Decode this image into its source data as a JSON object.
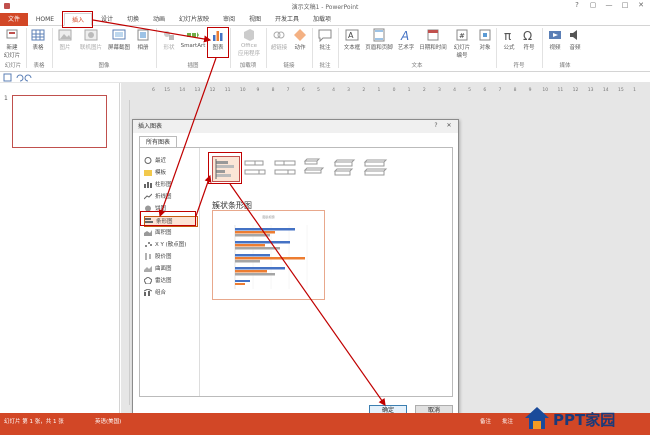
{
  "titlebar": {
    "title": "演示文稿1 - PowerPoint",
    "buttons": [
      "?",
      "▢",
      "—",
      "□",
      "✕"
    ]
  },
  "tabs": [
    {
      "label": "文件"
    },
    {
      "label": "HOME"
    },
    {
      "label": "插入"
    },
    {
      "label": "设计"
    },
    {
      "label": "切换"
    },
    {
      "label": "动画"
    },
    {
      "label": "幻灯片放映"
    },
    {
      "label": "审阅"
    },
    {
      "label": "视图"
    },
    {
      "label": "开发工具"
    },
    {
      "label": "加载项"
    }
  ],
  "ribbon": {
    "buttons": [
      {
        "label": "新建\n幻灯片"
      },
      {
        "label": "表格"
      },
      {
        "label": "图片"
      },
      {
        "label": "联机图片"
      },
      {
        "label": "屏幕截图"
      },
      {
        "label": "相册"
      },
      {
        "label": "形状"
      },
      {
        "label": "SmartArt"
      },
      {
        "label": "图表"
      },
      {
        "label": "Office\n应用程序"
      },
      {
        "label": "超链接"
      },
      {
        "label": "动作"
      },
      {
        "label": "批注"
      },
      {
        "label": "文本框"
      },
      {
        "label": "页眉和页脚"
      },
      {
        "label": "艺术字"
      },
      {
        "label": "日期和时间"
      },
      {
        "label": "幻灯片\n编号"
      },
      {
        "label": "对象"
      },
      {
        "label": "公式"
      },
      {
        "label": "符号"
      },
      {
        "label": "视频"
      },
      {
        "label": "音频"
      }
    ],
    "groups": [
      {
        "label": "幻灯片"
      },
      {
        "label": "表格"
      },
      {
        "label": "图像"
      },
      {
        "label": "插图"
      },
      {
        "label": "加载项"
      },
      {
        "label": "链接"
      },
      {
        "label": "批注"
      },
      {
        "label": "文本"
      },
      {
        "label": "符号"
      },
      {
        "label": "媒体"
      }
    ]
  },
  "leftpane": {
    "slide_number": "1"
  },
  "ruler": {
    "ticks": [
      "16",
      "15",
      "14",
      "13",
      "12",
      "11",
      "10",
      "9",
      "8",
      "7",
      "6",
      "5",
      "4",
      "3",
      "2",
      "1",
      "0",
      "1",
      "2",
      "3",
      "4",
      "5",
      "6",
      "7",
      "8",
      "9",
      "10",
      "11",
      "12",
      "13",
      "14",
      "15",
      "16"
    ]
  },
  "dialog": {
    "title": "插入图表",
    "tab_label": "所有图表",
    "categories": [
      {
        "label": "最近"
      },
      {
        "label": "模板"
      },
      {
        "label": "柱形图"
      },
      {
        "label": "折线图"
      },
      {
        "label": "饼图"
      },
      {
        "label": "条形图"
      },
      {
        "label": "面积图"
      },
      {
        "label": "X Y (散点图)"
      },
      {
        "label": "股价图"
      },
      {
        "label": "曲面图"
      },
      {
        "label": "雷达图"
      },
      {
        "label": "组合"
      }
    ],
    "selected_category": "条形图",
    "subtype_name": "簇状条形图",
    "preview_title": "图表标题",
    "ok_label": "确定",
    "cancel_label": "取消"
  },
  "status": {
    "left_text": "幻灯片 第 1 张，共 1 张",
    "language": "英语(美国)",
    "notes_label": "备注",
    "comments_label": "批注"
  },
  "watermark": {
    "text": "PPT家园"
  },
  "colors": {
    "accent": "#d24726",
    "highlight": "#c00000"
  }
}
